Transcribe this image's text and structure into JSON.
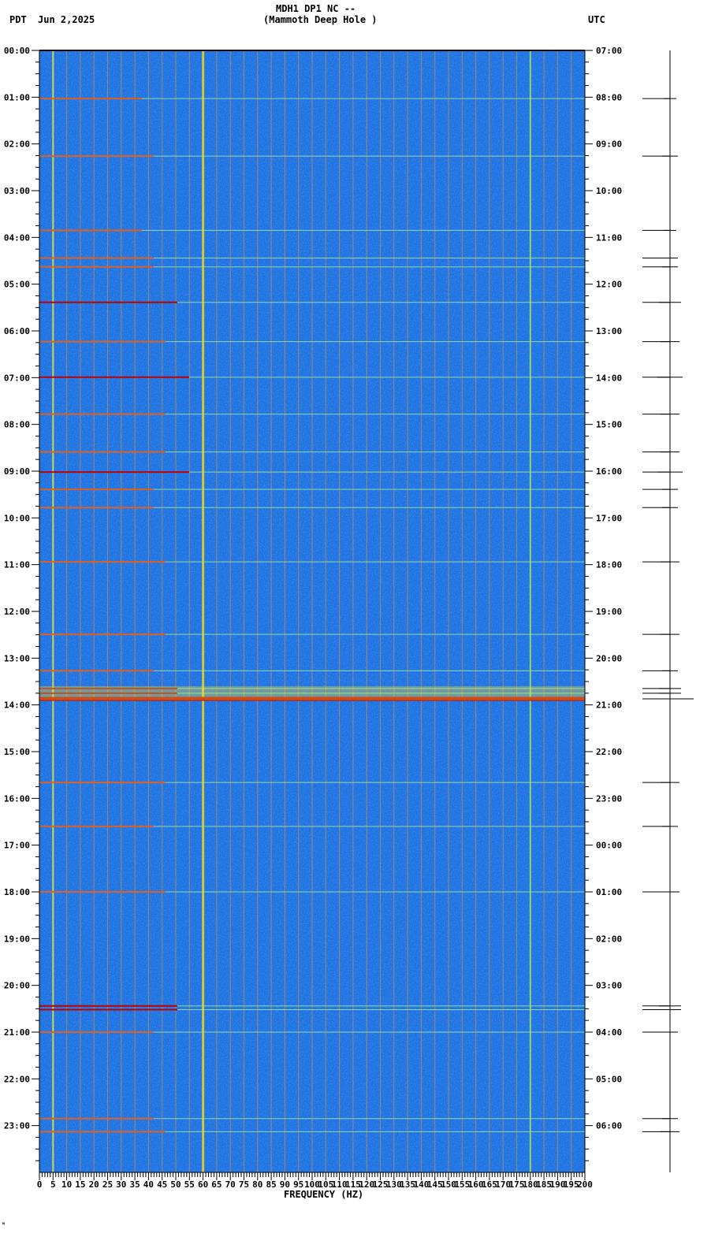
{
  "header": {
    "title": "MDH1 DP1 NC --",
    "subtitle": "(Mammoth Deep Hole )",
    "left_tz": "PDT",
    "date": "Jun 2,2025",
    "right_tz": "UTC"
  },
  "corner_mark": "ᴹ",
  "chart_data": {
    "type": "heatmap",
    "title": "MDH1 DP1 NC -- (Mammoth Deep Hole )",
    "xlabel": "FREQUENCY (HZ)",
    "xlim": [
      0,
      200
    ],
    "ylim_hours": [
      0,
      24
    ],
    "x_ticks": [
      "0",
      "5",
      "10",
      "15",
      "20",
      "25",
      "30",
      "35",
      "40",
      "45",
      "50",
      "55",
      "60",
      "65",
      "70",
      "75",
      "80",
      "85",
      "90",
      "95",
      "100",
      "105",
      "110",
      "115",
      "120",
      "125",
      "130",
      "135",
      "140",
      "145",
      "150",
      "155",
      "160",
      "165",
      "170",
      "175",
      "180",
      "185",
      "190",
      "195",
      "200"
    ],
    "left_time_labels": [
      "00:00",
      "01:00",
      "02:00",
      "03:00",
      "04:00",
      "05:00",
      "06:00",
      "07:00",
      "08:00",
      "09:00",
      "10:00",
      "11:00",
      "12:00",
      "13:00",
      "14:00",
      "15:00",
      "16:00",
      "17:00",
      "18:00",
      "19:00",
      "20:00",
      "21:00",
      "22:00",
      "23:00"
    ],
    "right_time_labels": [
      "07:00",
      "08:00",
      "09:00",
      "10:00",
      "11:00",
      "12:00",
      "13:00",
      "14:00",
      "15:00",
      "16:00",
      "17:00",
      "18:00",
      "19:00",
      "20:00",
      "21:00",
      "22:00",
      "23:00",
      "00:00",
      "01:00",
      "02:00",
      "03:00",
      "04:00",
      "05:00",
      "06:00"
    ],
    "background_color": "#1f6fe0",
    "persistent_lines_hz": [
      {
        "hz": 5,
        "color": "#e8e040"
      },
      {
        "hz": 60,
        "color": "#f0d020"
      },
      {
        "hz": 180,
        "color": "#9fe060"
      }
    ],
    "events": [
      {
        "hour": 1.03,
        "level": 0.4
      },
      {
        "hour": 2.26,
        "level": 0.5
      },
      {
        "hour": 3.85,
        "level": 0.4
      },
      {
        "hour": 4.44,
        "level": 0.5
      },
      {
        "hour": 4.63,
        "level": 0.5
      },
      {
        "hour": 5.39,
        "level": 0.7
      },
      {
        "hour": 6.23,
        "level": 0.6
      },
      {
        "hour": 6.99,
        "level": 0.8
      },
      {
        "hour": 7.78,
        "level": 0.6
      },
      {
        "hour": 8.59,
        "level": 0.6
      },
      {
        "hour": 9.02,
        "level": 0.8
      },
      {
        "hour": 9.39,
        "level": 0.5
      },
      {
        "hour": 9.78,
        "level": 0.5
      },
      {
        "hour": 10.94,
        "level": 0.6
      },
      {
        "hour": 12.49,
        "level": 0.6
      },
      {
        "hour": 13.27,
        "level": 0.5
      },
      {
        "hour": 13.65,
        "level": 0.7
      },
      {
        "hour": 13.75,
        "level": 0.7
      },
      {
        "hour": 13.87,
        "level": 1.0
      },
      {
        "hour": 15.66,
        "level": 0.6
      },
      {
        "hour": 16.6,
        "level": 0.5
      },
      {
        "hour": 18.0,
        "level": 0.6
      },
      {
        "hour": 20.44,
        "level": 0.7
      },
      {
        "hour": 20.52,
        "level": 0.7
      },
      {
        "hour": 21.0,
        "level": 0.5
      },
      {
        "hour": 22.85,
        "level": 0.5
      },
      {
        "hour": 23.13,
        "level": 0.6
      }
    ]
  }
}
